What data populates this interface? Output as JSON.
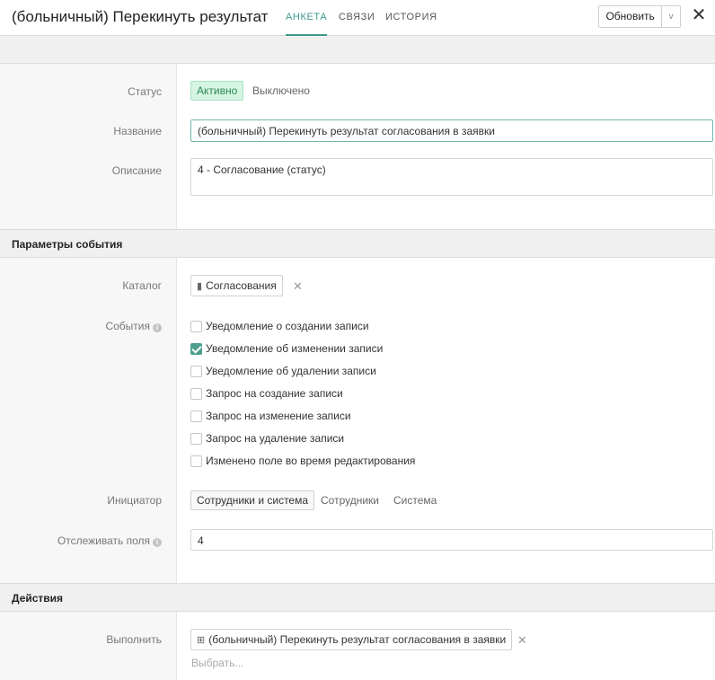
{
  "header": {
    "title": "(больничный) Перекинуть результат",
    "tabs": [
      {
        "label": "АНКЕТА",
        "active": true
      },
      {
        "label": "СВЯЗИ",
        "active": false
      },
      {
        "label": "ИСТОРИЯ",
        "active": false
      }
    ],
    "refresh_label": "Обновить",
    "refresh_caret": "v",
    "close_icon": "close-icon"
  },
  "form": {
    "status": {
      "label": "Статус",
      "options": [
        "Активно",
        "Выключено"
      ],
      "selected": "Активно"
    },
    "name": {
      "label": "Название",
      "value": "(больничный) Перекинуть результат согласования в заявки"
    },
    "description": {
      "label": "Описание",
      "value": "4 - Согласование (статус)"
    }
  },
  "event_params": {
    "section_title": "Параметры события",
    "catalog": {
      "label": "Каталог",
      "value": "Согласования",
      "icon": "book-icon"
    },
    "events": {
      "label": "События",
      "items": [
        {
          "label": "Уведомление о создании записи",
          "checked": false
        },
        {
          "label": "Уведомление об изменении записи",
          "checked": true
        },
        {
          "label": "Уведомление об удалении записи",
          "checked": false
        },
        {
          "label": "Запрос на создание записи",
          "checked": false
        },
        {
          "label": "Запрос на изменение записи",
          "checked": false
        },
        {
          "label": "Запрос на удаление записи",
          "checked": false
        },
        {
          "label": "Изменено поле во время редактирования",
          "checked": false
        }
      ]
    },
    "initiator": {
      "label": "Инициатор",
      "options": [
        "Сотрудники и система",
        "Сотрудники",
        "Система"
      ],
      "selected": "Сотрудники и система"
    },
    "track_fields": {
      "label": "Отслеживать поля",
      "value": "4"
    }
  },
  "actions": {
    "section_title": "Действия",
    "execute": {
      "label": "Выполнить",
      "value": "(больничный) Перекинуть результат согласования в заявки",
      "icon": "hierarchy-icon",
      "placeholder": "Выбрать..."
    }
  },
  "colors": {
    "accent": "#3d9a8b",
    "active_bg": "#d5f5e3",
    "active_text": "#2c8a55",
    "check": "#4d9e8f"
  }
}
